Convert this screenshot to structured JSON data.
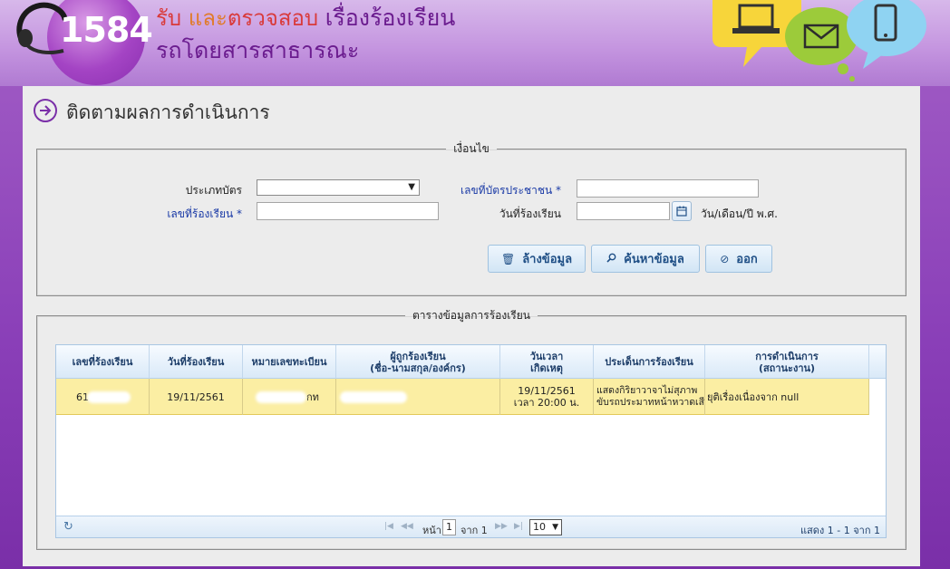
{
  "header": {
    "hotline": "1584",
    "title_part1": "รับ",
    "title_part2": "และ",
    "title_part3": "ตรวจสอบ",
    "title_part4": "เรื่องร้องเรียน",
    "title_line2": "รถโดยสารสาธารณะ"
  },
  "page": {
    "title": "ติดตามผลการดำเนินการ"
  },
  "conditions": {
    "legend": "เงื่อนไข",
    "card_type_label": "ประเภทบัตร",
    "card_type_value": "",
    "id_card_label": "เลขที่บัตรประชาชน *",
    "id_card_value": "",
    "complaint_no_label": "เลขที่ร้องเรียน *",
    "complaint_no_value": "",
    "complaint_date_label": "วันที่ร้องเรียน",
    "complaint_date_value": "",
    "date_format_hint": "วัน/เดือน/ปี พ.ศ.",
    "clear_button": "ล้างข้อมูล",
    "search_button": "ค้นหาข้อมูล",
    "exit_button": "ออก"
  },
  "table": {
    "legend": "ตารางข้อมูลการร้องเรียน",
    "columns": [
      {
        "line1": "เลขที่ร้องเรียน",
        "line2": ""
      },
      {
        "line1": "วันที่ร้องเรียน",
        "line2": ""
      },
      {
        "line1": "หมายเลขทะเบียน",
        "line2": ""
      },
      {
        "line1": "ผู้ถูกร้องเรียน",
        "line2": "(ชื่อ-นามสกุล/องค์กร)"
      },
      {
        "line1": "วันเวลา",
        "line2": "เกิดเหตุ"
      },
      {
        "line1": "ประเด็นการร้องเรียน",
        "line2": ""
      },
      {
        "line1": "การดำเนินการ",
        "line2": "(สถานะงาน)"
      }
    ],
    "rows": [
      {
        "complaint_no": "61",
        "complaint_date": "19/11/2561",
        "plate_suffix": "กท",
        "accused": "",
        "incident_date": "19/11/2561",
        "incident_time": "เวลา 20:00 น.",
        "issue_line1": "แสดงกิริยาวาจาไม่สุภาพ",
        "issue_line2": "ขับรถประมาทหน้าหวาดเสียว",
        "status": "ยุติเรื่องเนื่องจาก null"
      }
    ],
    "pager": {
      "page_label": "หน้า",
      "current_page": "1",
      "of_label": "จาก 1",
      "page_size": "10",
      "view_text": "แสดง 1 - 1 จาก 1"
    }
  },
  "colors": {
    "brand_purple": "#7a2fa8",
    "row_highlight": "#fbeea3",
    "required_label": "#1a3aa6"
  }
}
